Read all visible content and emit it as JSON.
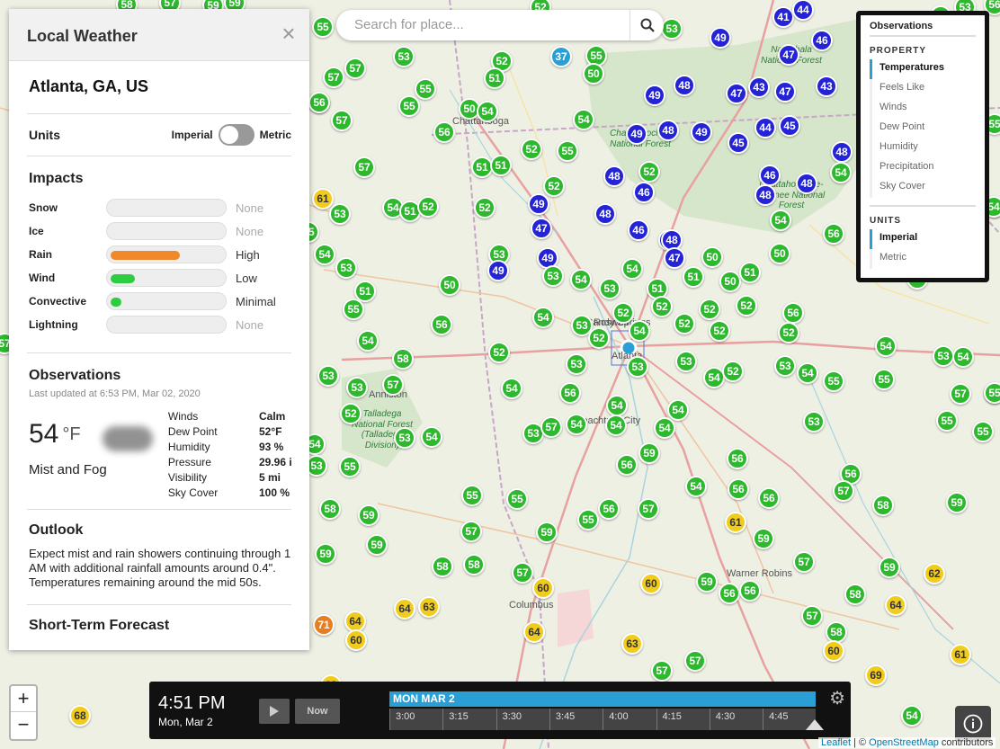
{
  "panel": {
    "title": "Local Weather",
    "close_label": "×",
    "location": "Atlanta, GA, US",
    "units": {
      "label": "Units",
      "imperial": "Imperial",
      "metric": "Metric"
    },
    "impacts": {
      "title": "Impacts",
      "items": [
        {
          "name": "Snow",
          "level": "None",
          "fill": 0,
          "color": "#dddddd"
        },
        {
          "name": "Ice",
          "level": "None",
          "fill": 0,
          "color": "#dddddd"
        },
        {
          "name": "Rain",
          "level": "High",
          "fill": 0.62,
          "color": "#f0892a"
        },
        {
          "name": "Wind",
          "level": "Low",
          "fill": 0.22,
          "color": "#2ecc40"
        },
        {
          "name": "Convective",
          "level": "Minimal",
          "fill": 0.1,
          "color": "#2ecc40"
        },
        {
          "name": "Lightning",
          "level": "None",
          "fill": 0,
          "color": "#dddddd"
        }
      ]
    },
    "observations": {
      "title": "Observations",
      "updated": "Last updated at 6:53 PM, Mar 02, 2020",
      "temp": "54",
      "temp_unit": "°F",
      "condition": "Mist and Fog",
      "rows": [
        {
          "k": "Winds",
          "v": "Calm"
        },
        {
          "k": "Dew Point",
          "v": "52°F"
        },
        {
          "k": "Humidity",
          "v": "93 %"
        },
        {
          "k": "Pressure",
          "v": "29.96 i"
        },
        {
          "k": "Visibility",
          "v": "5 mi"
        },
        {
          "k": "Sky Cover",
          "v": "100 %"
        }
      ]
    },
    "outlook": {
      "title": "Outlook",
      "text": "Expect mist and rain showers continuing through 1 AM with additional rainfall amounts around 0.4\". Temperatures remaining around the mid 50s."
    },
    "short_term": {
      "title": "Short-Term Forecast"
    }
  },
  "search": {
    "placeholder": "Search for place..."
  },
  "legend": {
    "title": "Observations",
    "property_title": "PROPERTY",
    "properties": [
      "Temperatures",
      "Feels Like",
      "Winds",
      "Dew Point",
      "Humidity",
      "Precipitation",
      "Sky Cover"
    ],
    "active_property": "Temperatures",
    "units_title": "UNITS",
    "units": [
      "Imperial",
      "Metric"
    ],
    "active_unit": "Imperial"
  },
  "zoom": {
    "in": "+",
    "out": "−"
  },
  "timeline": {
    "time": "4:51 PM",
    "date": "Mon, Mar 2",
    "now_label": "Now",
    "day_label": "MON MAR 2",
    "ticks": [
      "3:00",
      "3:15",
      "3:30",
      "3:45",
      "4:00",
      "4:15",
      "4:30",
      "4:45"
    ]
  },
  "attribution": {
    "leaflet": "Leaflet",
    "sep": " | © ",
    "osm": "OpenStreetMap",
    "rest": " contributors"
  },
  "map": {
    "colors": {
      "blue": "#2424d6",
      "green": "#2eb82e",
      "yellow": "#f2cc1d",
      "orange": "#e67e22",
      "cyan": "#2a9fd6"
    },
    "labels": [
      "Chattanooga",
      "Roswell",
      "Sandy Springs",
      "Atlanta",
      "Anniston",
      "Columbus",
      "Warner Robins",
      "Peachtree City",
      "Talladega National Forest (Talladega Division)",
      "Chattahoochee National Forest",
      "Nantahala National Forest",
      "Chattahoochee-Oconee National Forest"
    ],
    "markers": [
      {
        "v": "58",
        "c": "green"
      },
      {
        "v": "57",
        "c": "green"
      },
      {
        "v": "59",
        "c": "green"
      },
      {
        "v": "59",
        "c": "green"
      },
      {
        "v": "52",
        "c": "green"
      },
      {
        "v": "55",
        "c": "green"
      },
      {
        "v": "57",
        "c": "green"
      },
      {
        "v": "57",
        "c": "green"
      },
      {
        "v": "53",
        "c": "green"
      },
      {
        "v": "56",
        "c": "green"
      },
      {
        "v": "52",
        "c": "green"
      },
      {
        "v": "51",
        "c": "green"
      },
      {
        "v": "37",
        "c": "cyan"
      },
      {
        "v": "55",
        "c": "green"
      },
      {
        "v": "50",
        "c": "green"
      },
      {
        "v": "53",
        "c": "green"
      },
      {
        "v": "49",
        "c": "blue"
      },
      {
        "v": "41",
        "c": "blue"
      },
      {
        "v": "44",
        "c": "blue"
      },
      {
        "v": "46",
        "c": "blue"
      },
      {
        "v": "47",
        "c": "blue"
      },
      {
        "v": "56",
        "c": "green"
      },
      {
        "v": "55",
        "c": "green"
      },
      {
        "v": "55",
        "c": "green"
      },
      {
        "v": "56",
        "c": "green"
      },
      {
        "v": "57",
        "c": "green"
      },
      {
        "v": "50",
        "c": "green"
      },
      {
        "v": "54",
        "c": "green"
      },
      {
        "v": "54",
        "c": "green"
      },
      {
        "v": "49",
        "c": "blue"
      },
      {
        "v": "48",
        "c": "blue"
      },
      {
        "v": "47",
        "c": "blue"
      },
      {
        "v": "43",
        "c": "blue"
      },
      {
        "v": "47",
        "c": "blue"
      },
      {
        "v": "43",
        "c": "blue"
      },
      {
        "v": "56",
        "c": "green"
      },
      {
        "v": "49",
        "c": "blue"
      },
      {
        "v": "48",
        "c": "blue"
      },
      {
        "v": "49",
        "c": "blue"
      },
      {
        "v": "45",
        "c": "blue"
      },
      {
        "v": "44",
        "c": "blue"
      },
      {
        "v": "45",
        "c": "blue"
      },
      {
        "v": "52",
        "c": "green"
      },
      {
        "v": "55",
        "c": "green"
      },
      {
        "v": "57",
        "c": "green"
      },
      {
        "v": "51",
        "c": "green"
      },
      {
        "v": "51",
        "c": "green"
      },
      {
        "v": "52",
        "c": "green"
      },
      {
        "v": "48",
        "c": "blue"
      },
      {
        "v": "52",
        "c": "green"
      },
      {
        "v": "46",
        "c": "blue"
      },
      {
        "v": "46",
        "c": "blue"
      },
      {
        "v": "48",
        "c": "blue"
      },
      {
        "v": "48",
        "c": "blue"
      },
      {
        "v": "48",
        "c": "blue"
      },
      {
        "v": "54",
        "c": "green"
      },
      {
        "v": "61",
        "c": "yellow"
      },
      {
        "v": "53",
        "c": "green"
      },
      {
        "v": "54",
        "c": "green"
      },
      {
        "v": "51",
        "c": "green"
      },
      {
        "v": "52",
        "c": "green"
      },
      {
        "v": "52",
        "c": "green"
      },
      {
        "v": "49",
        "c": "blue"
      },
      {
        "v": "48",
        "c": "blue"
      },
      {
        "v": "46",
        "c": "blue"
      },
      {
        "v": "47",
        "c": "blue"
      },
      {
        "v": "54",
        "c": "green"
      },
      {
        "v": "47",
        "c": "blue"
      },
      {
        "v": "48",
        "c": "blue"
      },
      {
        "v": "47",
        "c": "blue"
      },
      {
        "v": "50",
        "c": "green"
      },
      {
        "v": "56",
        "c": "green"
      },
      {
        "v": "54",
        "c": "green"
      },
      {
        "v": "53",
        "c": "green"
      },
      {
        "v": "53",
        "c": "green"
      },
      {
        "v": "49",
        "c": "blue"
      },
      {
        "v": "49",
        "c": "blue"
      },
      {
        "v": "50",
        "c": "green"
      },
      {
        "v": "53",
        "c": "green"
      },
      {
        "v": "54",
        "c": "green"
      },
      {
        "v": "53",
        "c": "green"
      },
      {
        "v": "54",
        "c": "green"
      },
      {
        "v": "51",
        "c": "green"
      },
      {
        "v": "50",
        "c": "green"
      },
      {
        "v": "51",
        "c": "green"
      },
      {
        "v": "51",
        "c": "green"
      },
      {
        "v": "50",
        "c": "green"
      },
      {
        "v": "51",
        "c": "green"
      },
      {
        "v": "55",
        "c": "green"
      },
      {
        "v": "56",
        "c": "green"
      },
      {
        "v": "54",
        "c": "green"
      },
      {
        "v": "53",
        "c": "green"
      },
      {
        "v": "52",
        "c": "green"
      },
      {
        "v": "52",
        "c": "green"
      },
      {
        "v": "52",
        "c": "green"
      },
      {
        "v": "52",
        "c": "green"
      },
      {
        "v": "52",
        "c": "green"
      },
      {
        "v": "52",
        "c": "green"
      },
      {
        "v": "52",
        "c": "green"
      },
      {
        "v": "54",
        "c": "green"
      },
      {
        "v": "56",
        "c": "green"
      },
      {
        "v": "54",
        "c": "green"
      },
      {
        "v": "52",
        "c": "green"
      },
      {
        "v": "52",
        "c": "green"
      },
      {
        "v": "53",
        "c": "green"
      },
      {
        "v": "53",
        "c": "green"
      },
      {
        "v": "54",
        "c": "green"
      },
      {
        "v": "58",
        "c": "green"
      },
      {
        "v": "53",
        "c": "green"
      },
      {
        "v": "53",
        "c": "green"
      },
      {
        "v": "57",
        "c": "green"
      },
      {
        "v": "54",
        "c": "green"
      },
      {
        "v": "56",
        "c": "green"
      },
      {
        "v": "53",
        "c": "green"
      },
      {
        "v": "54",
        "c": "green"
      },
      {
        "v": "52",
        "c": "green"
      },
      {
        "v": "53",
        "c": "green"
      },
      {
        "v": "54",
        "c": "green"
      },
      {
        "v": "55",
        "c": "green"
      },
      {
        "v": "55",
        "c": "green"
      },
      {
        "v": "53",
        "c": "green"
      },
      {
        "v": "54",
        "c": "green"
      },
      {
        "v": "57",
        "c": "green"
      },
      {
        "v": "53",
        "c": "green"
      },
      {
        "v": "52",
        "c": "green"
      },
      {
        "v": "53",
        "c": "green"
      },
      {
        "v": "54",
        "c": "green"
      },
      {
        "v": "53",
        "c": "green"
      },
      {
        "v": "57",
        "c": "green"
      },
      {
        "v": "54",
        "c": "green"
      },
      {
        "v": "54",
        "c": "green"
      },
      {
        "v": "54",
        "c": "green"
      },
      {
        "v": "54",
        "c": "green"
      },
      {
        "v": "54",
        "c": "green"
      },
      {
        "v": "53",
        "c": "green"
      },
      {
        "v": "55",
        "c": "green"
      },
      {
        "v": "55",
        "c": "green"
      },
      {
        "v": "54",
        "c": "green"
      },
      {
        "v": "53",
        "c": "green"
      },
      {
        "v": "55",
        "c": "green"
      },
      {
        "v": "56",
        "c": "green"
      },
      {
        "v": "59",
        "c": "green"
      },
      {
        "v": "56",
        "c": "green"
      },
      {
        "v": "55",
        "c": "green"
      },
      {
        "v": "55",
        "c": "green"
      },
      {
        "v": "54",
        "c": "green"
      },
      {
        "v": "56",
        "c": "green"
      },
      {
        "v": "56",
        "c": "green"
      },
      {
        "v": "56",
        "c": "green"
      },
      {
        "v": "57",
        "c": "green"
      },
      {
        "v": "58",
        "c": "green"
      },
      {
        "v": "59",
        "c": "green"
      },
      {
        "v": "58",
        "c": "green"
      },
      {
        "v": "59",
        "c": "green"
      },
      {
        "v": "57",
        "c": "green"
      },
      {
        "v": "59",
        "c": "green"
      },
      {
        "v": "55",
        "c": "green"
      },
      {
        "v": "56",
        "c": "green"
      },
      {
        "v": "57",
        "c": "green"
      },
      {
        "v": "61",
        "c": "yellow"
      },
      {
        "v": "59",
        "c": "green"
      },
      {
        "v": "59",
        "c": "green"
      },
      {
        "v": "59",
        "c": "green"
      },
      {
        "v": "58",
        "c": "green"
      },
      {
        "v": "58",
        "c": "green"
      },
      {
        "v": "57",
        "c": "green"
      },
      {
        "v": "60",
        "c": "yellow"
      },
      {
        "v": "60",
        "c": "yellow"
      },
      {
        "v": "59",
        "c": "green"
      },
      {
        "v": "56",
        "c": "green"
      },
      {
        "v": "56",
        "c": "green"
      },
      {
        "v": "57",
        "c": "green"
      },
      {
        "v": "58",
        "c": "green"
      },
      {
        "v": "59",
        "c": "green"
      },
      {
        "v": "64",
        "c": "yellow"
      },
      {
        "v": "62",
        "c": "yellow"
      },
      {
        "v": "64",
        "c": "yellow"
      },
      {
        "v": "63",
        "c": "yellow"
      },
      {
        "v": "71",
        "c": "orange"
      },
      {
        "v": "64",
        "c": "yellow"
      },
      {
        "v": "60",
        "c": "yellow"
      },
      {
        "v": "64",
        "c": "yellow"
      },
      {
        "v": "63",
        "c": "yellow"
      },
      {
        "v": "57",
        "c": "green"
      },
      {
        "v": "57",
        "c": "green"
      },
      {
        "v": "57",
        "c": "green"
      },
      {
        "v": "58",
        "c": "green"
      },
      {
        "v": "60",
        "c": "yellow"
      },
      {
        "v": "61",
        "c": "yellow"
      },
      {
        "v": "69",
        "c": "yellow"
      },
      {
        "v": "68",
        "c": "yellow"
      },
      {
        "v": "68",
        "c": "yellow"
      },
      {
        "v": "68",
        "c": "yellow"
      },
      {
        "v": "54",
        "c": "green"
      },
      {
        "v": "57",
        "c": "green"
      },
      {
        "v": "55",
        "c": "green"
      },
      {
        "v": "55",
        "c": "green"
      },
      {
        "v": "51",
        "c": "green"
      },
      {
        "v": "53",
        "c": "green"
      },
      {
        "v": "53",
        "c": "green"
      },
      {
        "v": "55",
        "c": "green"
      },
      {
        "v": "54",
        "c": "green"
      },
      {
        "v": "55",
        "c": "green"
      },
      {
        "v": "53",
        "c": "green"
      },
      {
        "v": "54",
        "c": "green"
      }
    ]
  }
}
